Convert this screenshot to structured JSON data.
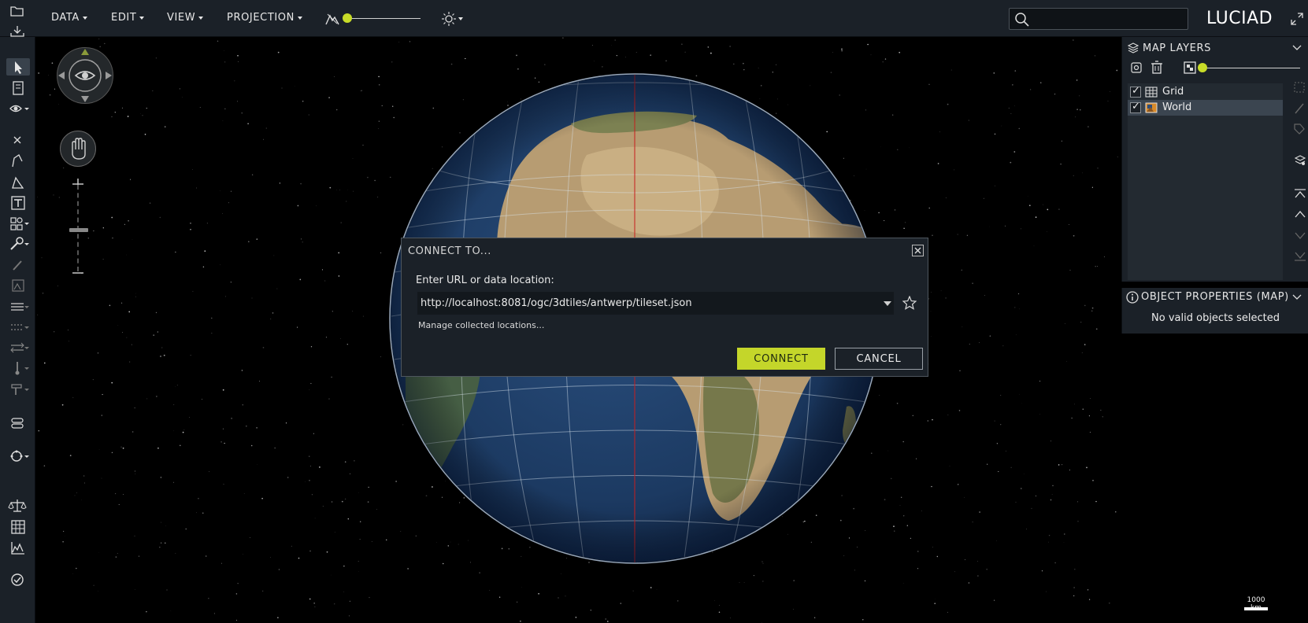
{
  "colors": {
    "accent": "#c4d62a",
    "chrome": "#1b2128",
    "map_background": "#000000",
    "meridian": "#c81e1e"
  },
  "topbar": {
    "menus": [
      {
        "label": "DATA"
      },
      {
        "label": "EDIT"
      },
      {
        "label": "VIEW"
      },
      {
        "label": "PROJECTION"
      }
    ],
    "search_placeholder": "",
    "logo": "LUCIAD"
  },
  "left_toolbar": {
    "icons": [
      "open-folder-icon",
      "download-icon",
      "select-arrow-icon",
      "bookmark-icon",
      "eye-icon",
      "close-icon",
      "polyline-icon",
      "polygon-icon",
      "text-icon",
      "shapes-icon",
      "wrench-icon",
      "pen-icon",
      "image-icon",
      "layers-lines-icon",
      "dashed-lines-icon",
      "arrows-icon",
      "thermometer-icon",
      "paint-roller-icon",
      "route-icon",
      "globe-draw-icon",
      "balance-icon",
      "table-icon",
      "chart-icon",
      "check-circle-icon"
    ]
  },
  "layers_panel": {
    "title": "MAP LAYERS",
    "layers": [
      {
        "name": "Grid",
        "checked": true,
        "selected": false,
        "icon": "grid-icon"
      },
      {
        "name": "World",
        "checked": true,
        "selected": true,
        "icon": "raster-image-icon"
      }
    ]
  },
  "properties_panel": {
    "title": "OBJECT PROPERTIES (MAP)",
    "message": "No valid objects selected"
  },
  "dialog": {
    "title": "CONNECT TO...",
    "url_label": "Enter URL or data location:",
    "url_value": "http://localhost:8081/ogc/3dtiles/antwerp/tileset.json",
    "manage_link": "Manage collected locations...",
    "connect_label": "CONNECT",
    "cancel_label": "CANCEL"
  },
  "scalebar": {
    "label": "1000 km"
  }
}
